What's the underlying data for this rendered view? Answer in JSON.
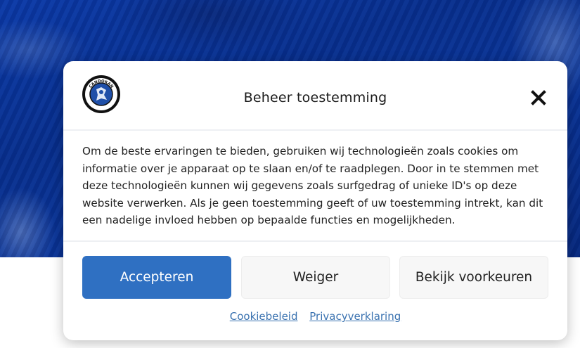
{
  "modal": {
    "title": "Beheer toestemming",
    "logo_text": "CANDOKAN",
    "body": "Om de beste ervaringen te bieden, gebruiken wij technologieën zoals cookies om informatie over je apparaat op te slaan en/of te raadplegen. Door in te stemmen met deze technologieën kunnen wij gegevens zoals surfgedrag of unieke ID's op deze website verwerken. Als je geen toestemming geeft of uw toestemming intrekt, kan dit een nadelige invloed hebben op bepaalde functies en mogelijkheden.",
    "buttons": {
      "accept": "Accepteren",
      "deny": "Weiger",
      "preferences": "Bekijk voorkeuren"
    },
    "links": {
      "cookie_policy": "Cookiebeleid",
      "privacy_statement": "Privacyverklaring"
    },
    "close_icon": "close-icon"
  },
  "colors": {
    "accent": "#2f70c2",
    "link": "#3a72b0",
    "hero": "#0b3aa8"
  }
}
